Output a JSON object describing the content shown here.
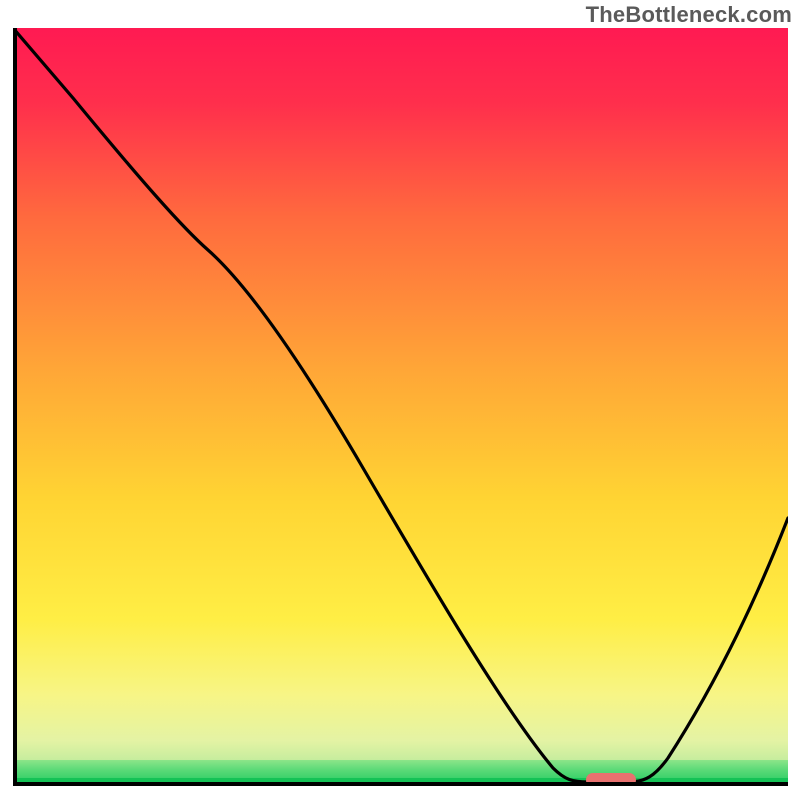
{
  "watermark": "TheBottleneck.com",
  "colors": {
    "gradient_top": "#ff1a52",
    "gradient_mid_orange": "#ffa637",
    "gradient_yellow": "#ffee45",
    "gradient_bottom_green": "#1ec95f",
    "curve": "#000000",
    "marker": "#e9716f",
    "axis": "#000000"
  },
  "chart_data": {
    "type": "line",
    "title": "",
    "xlabel": "",
    "ylabel": "",
    "xlim": [
      0,
      100
    ],
    "ylim": [
      0,
      100
    ],
    "grid": false,
    "legend": false,
    "series": [
      {
        "name": "bottleneck-curve",
        "x": [
          0,
          8,
          15,
          22,
          25,
          32,
          40,
          50,
          60,
          68,
          72,
          75,
          80,
          83,
          88,
          94,
          100
        ],
        "values": [
          100,
          91,
          81,
          73,
          71,
          62,
          48,
          32,
          16,
          5,
          1,
          0,
          0,
          2,
          10,
          25,
          35
        ]
      }
    ],
    "annotations": [
      {
        "name": "optimal-marker",
        "shape": "pill",
        "x_range": [
          74,
          80
        ],
        "y": 0,
        "color": "#e9716f"
      }
    ],
    "background": {
      "type": "vertical-gradient",
      "stops": [
        {
          "pct": 0,
          "color": "#ff1a52"
        },
        {
          "pct": 25,
          "color": "#ff6a3e"
        },
        {
          "pct": 45,
          "color": "#ffa637"
        },
        {
          "pct": 62,
          "color": "#ffd433"
        },
        {
          "pct": 78,
          "color": "#ffee45"
        },
        {
          "pct": 94,
          "color": "#e4f3a4"
        },
        {
          "pct": 100,
          "color": "#1ec95f"
        }
      ]
    }
  }
}
